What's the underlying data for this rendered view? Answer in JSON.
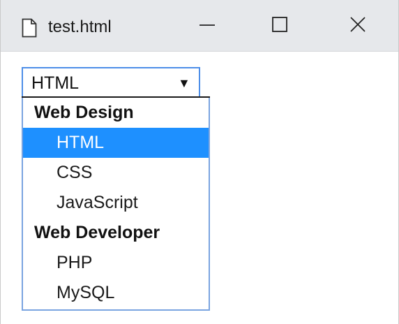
{
  "window": {
    "title": "test.html",
    "icons": {
      "file": "file-icon",
      "minimize": "minimize-icon",
      "maximize": "maximize-icon",
      "close": "close-icon"
    }
  },
  "select": {
    "value": "HTML",
    "arrow": "▼",
    "colors": {
      "focus_border": "#4d8ee8",
      "highlight": "#1e90ff"
    },
    "groups": [
      {
        "label": "Web Design",
        "options": [
          "HTML",
          "CSS",
          "JavaScript"
        ]
      },
      {
        "label": "Web Developer",
        "options": [
          "PHP",
          "MySQL"
        ]
      }
    ],
    "selected_option": "HTML"
  }
}
